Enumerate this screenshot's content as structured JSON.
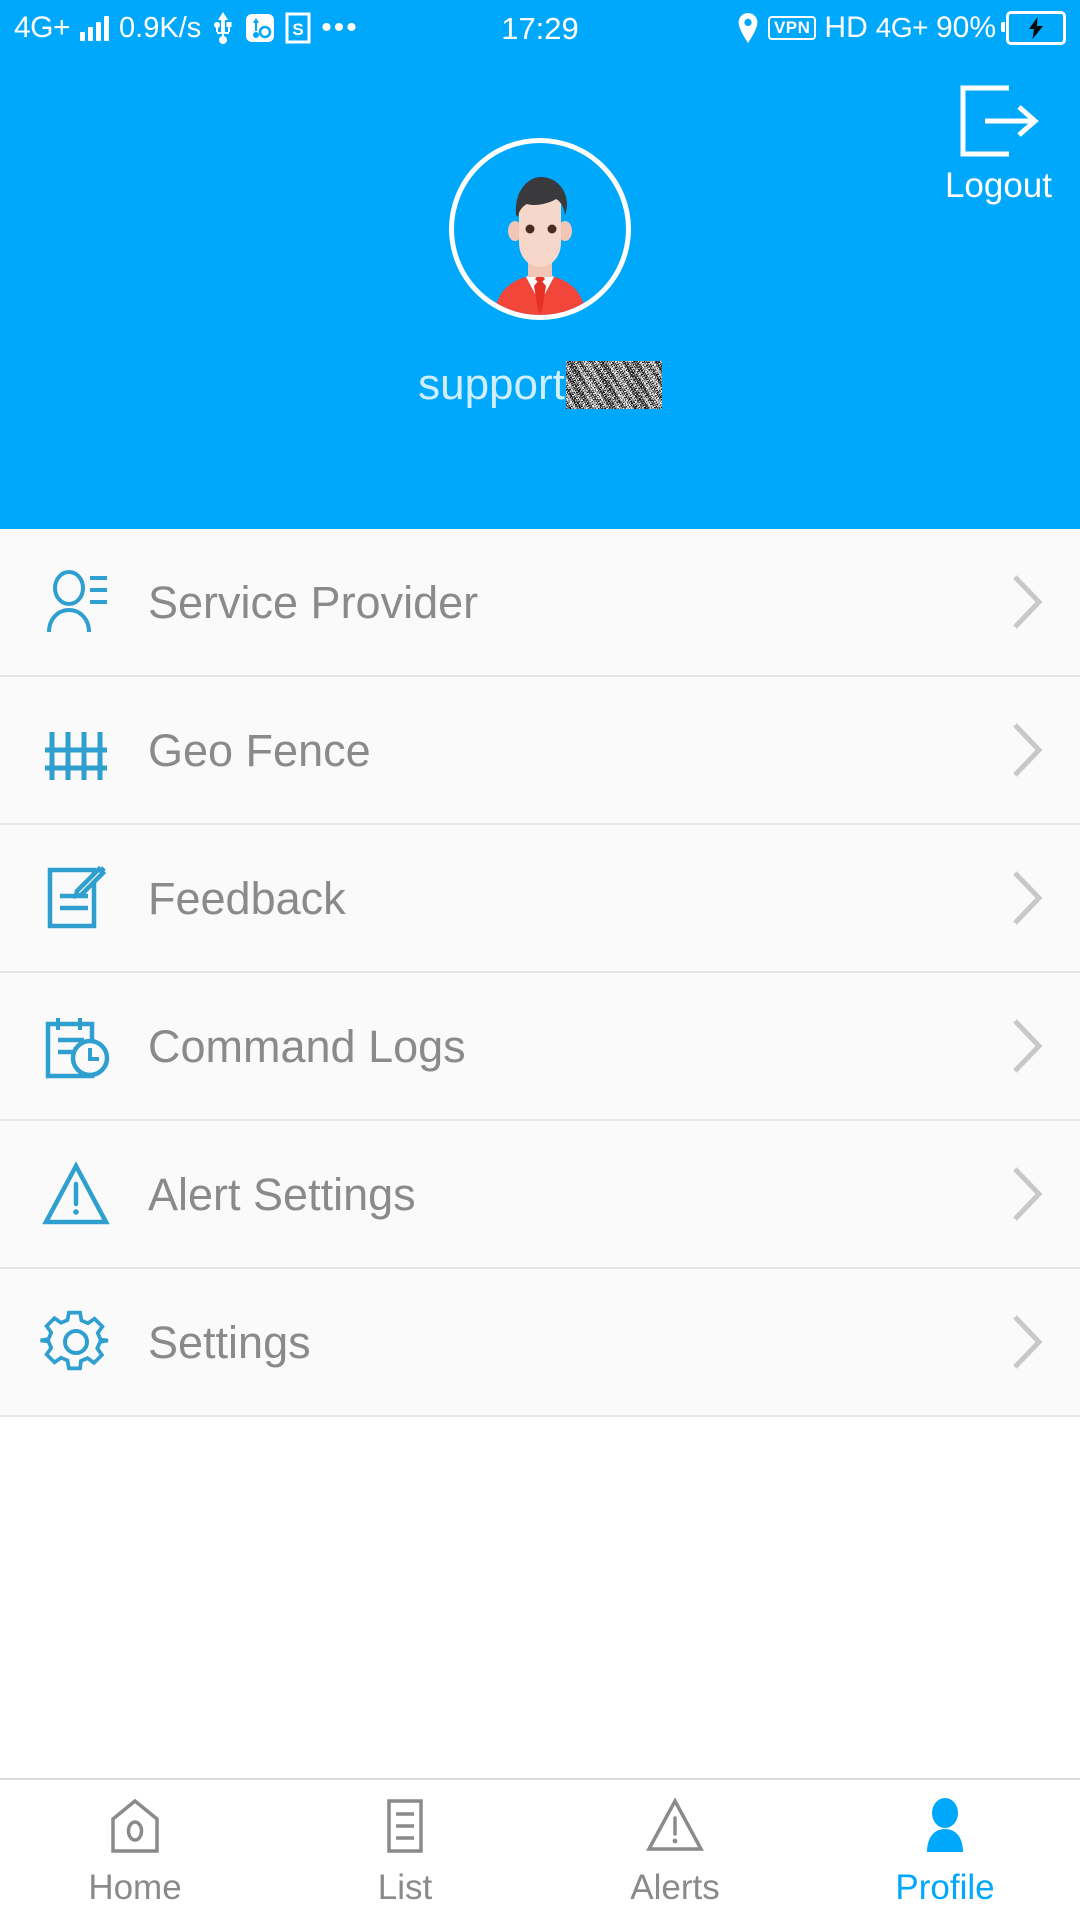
{
  "status_bar": {
    "network_label": "4G+",
    "signal_icon": "signal-bars-icon",
    "data_speed": "0.9K/s",
    "usb_icon": "usb-icon",
    "usb_debug_icon": "usb-debugging-icon",
    "sdcard_icon": "s-badge-icon",
    "more_icon": "more-dots-icon",
    "time": "17:29",
    "location_icon": "location-pin-icon",
    "vpn_label": "VPN",
    "hd_label": "HD",
    "network_label_2": "4G+",
    "battery_percent": "90%",
    "battery_icon": "battery-charging-icon"
  },
  "header": {
    "logout_label": "Logout",
    "logout_icon": "logout-arrow-icon",
    "avatar_icon": "user-avatar-illustration",
    "username": "support",
    "username_redacted": true,
    "background_color": "#00A8FC"
  },
  "menu": {
    "items": [
      {
        "label": "Service Provider",
        "icon": "contact-person-icon"
      },
      {
        "label": "Geo Fence",
        "icon": "fence-icon"
      },
      {
        "label": "Feedback",
        "icon": "document-pencil-icon"
      },
      {
        "label": "Command Logs",
        "icon": "notepad-clock-icon"
      },
      {
        "label": "Alert Settings",
        "icon": "warning-triangle-icon"
      },
      {
        "label": "Settings",
        "icon": "gear-icon"
      }
    ],
    "chevron_icon": "chevron-right-icon",
    "icon_color": "#2F9FD0",
    "label_color": "#8A8A8A"
  },
  "bottom_nav": {
    "active_color": "#00A8FC",
    "inactive_color": "#8A8A8A",
    "items": [
      {
        "label": "Home",
        "icon": "home-icon",
        "active": false
      },
      {
        "label": "List",
        "icon": "list-document-icon",
        "active": false
      },
      {
        "label": "Alerts",
        "icon": "warning-triangle-icon",
        "active": false
      },
      {
        "label": "Profile",
        "icon": "person-filled-icon",
        "active": true
      }
    ]
  }
}
